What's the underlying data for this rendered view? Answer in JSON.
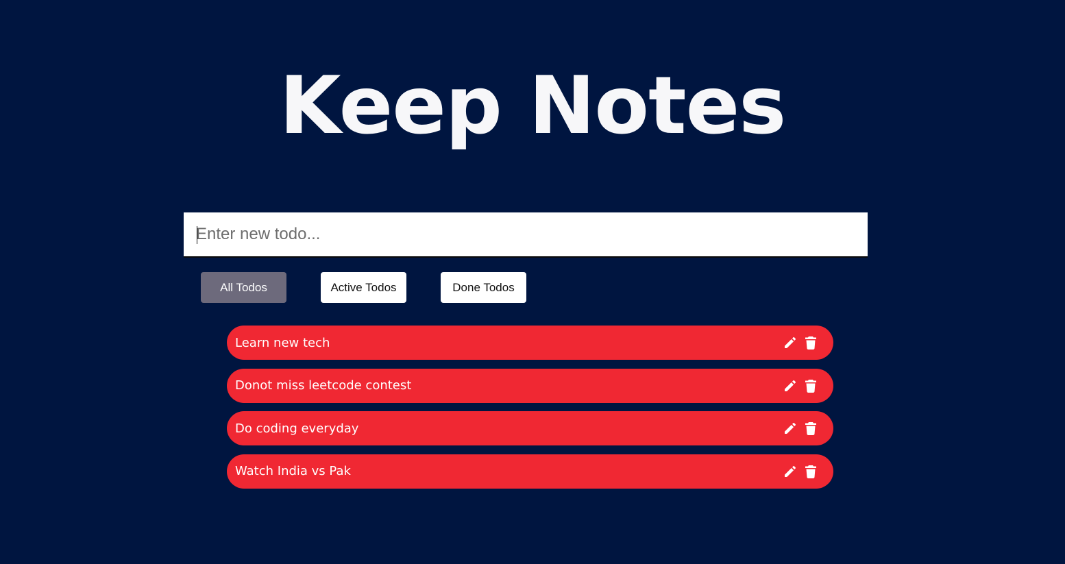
{
  "header": {
    "title": "Keep Notes"
  },
  "new_todo": {
    "placeholder": "Enter new todo...",
    "value": ""
  },
  "filters": [
    {
      "label": "All Todos",
      "active": true
    },
    {
      "label": "Active Todos",
      "active": false
    },
    {
      "label": "Done Todos",
      "active": false
    }
  ],
  "todos": [
    {
      "text": "Learn new tech"
    },
    {
      "text": "Donot miss leetcode contest"
    },
    {
      "text": "Do coding everyday"
    },
    {
      "text": "Watch India vs Pak"
    }
  ],
  "icons": {
    "edit": "pencil-icon",
    "delete": "trash-icon"
  },
  "colors": {
    "background": "#001540",
    "todo_item": "#f02833",
    "active_filter": "#6d6a7c",
    "title_text": "#f7f7f9"
  }
}
